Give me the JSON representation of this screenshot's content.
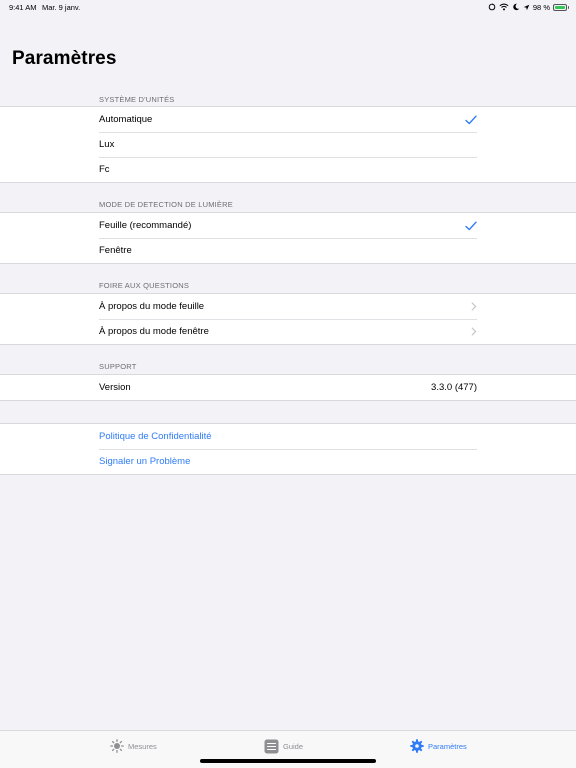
{
  "status_bar": {
    "time": "9:41 AM",
    "date": "Mar. 9 janv.",
    "battery": "98 %",
    "battery_level": 0.98
  },
  "page": {
    "title": "Paramètres"
  },
  "sections": {
    "units": {
      "header": "SYSTÈME D'UNITÉS",
      "items": [
        {
          "label": "Automatique",
          "selected": true
        },
        {
          "label": "Lux",
          "selected": false
        },
        {
          "label": "Fc",
          "selected": false
        }
      ]
    },
    "detection": {
      "header": "MODE DE DETECTION DE LUMIÈRE",
      "items": [
        {
          "label": "Feuille (recommandé)",
          "selected": true
        },
        {
          "label": "Fenêtre",
          "selected": false
        }
      ]
    },
    "faq": {
      "header": "FOIRE AUX QUESTIONS",
      "items": [
        {
          "label": "À propos du mode feuille"
        },
        {
          "label": "À propos du mode fenêtre"
        }
      ]
    },
    "support": {
      "header": "SUPPORT",
      "version_label": "Version",
      "version_value": "3.3.0 (477)"
    },
    "links": {
      "items": [
        {
          "label": "Politique de Confidentialité"
        },
        {
          "label": "Signaler un Problème"
        }
      ]
    }
  },
  "tab_bar": {
    "tabs": [
      {
        "label": "Mesures",
        "icon": "sun-icon",
        "active": false
      },
      {
        "label": "Guide",
        "icon": "guide-icon",
        "active": false
      },
      {
        "label": "Paramètres",
        "icon": "gear-icon",
        "active": true
      }
    ]
  },
  "colors": {
    "accent": "#2f7cf6",
    "background": "#f2f2f7",
    "secondary_text": "#6d6d72",
    "battery": "#34c759"
  }
}
